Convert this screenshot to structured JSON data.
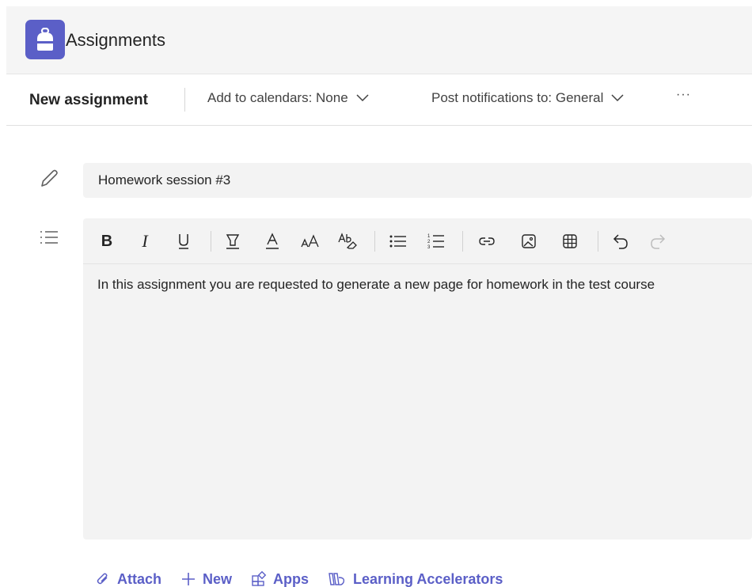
{
  "app": {
    "title": "Assignments"
  },
  "command_bar": {
    "title": "New assignment",
    "calendars_label": "Add to calendars: None",
    "notifications_label": "Post notifications to: General",
    "more_label": "···"
  },
  "assignment": {
    "title_value": "Homework session #3",
    "instructions": "In this assignment you are requested to generate a new page for homework in the test course"
  },
  "toolbar": {
    "items": [
      "bold",
      "italic",
      "underline",
      "highlight",
      "font-color",
      "font-size",
      "clear-formatting",
      "bulleted-list",
      "numbered-list",
      "link",
      "image",
      "table",
      "undo",
      "redo"
    ]
  },
  "bottom_actions": {
    "attach": "Attach",
    "new": "New",
    "apps": "Apps",
    "learning_accelerators": "Learning Accelerators"
  },
  "colors": {
    "accent": "#5b5fc7",
    "field_bg": "#f3f3f3"
  }
}
